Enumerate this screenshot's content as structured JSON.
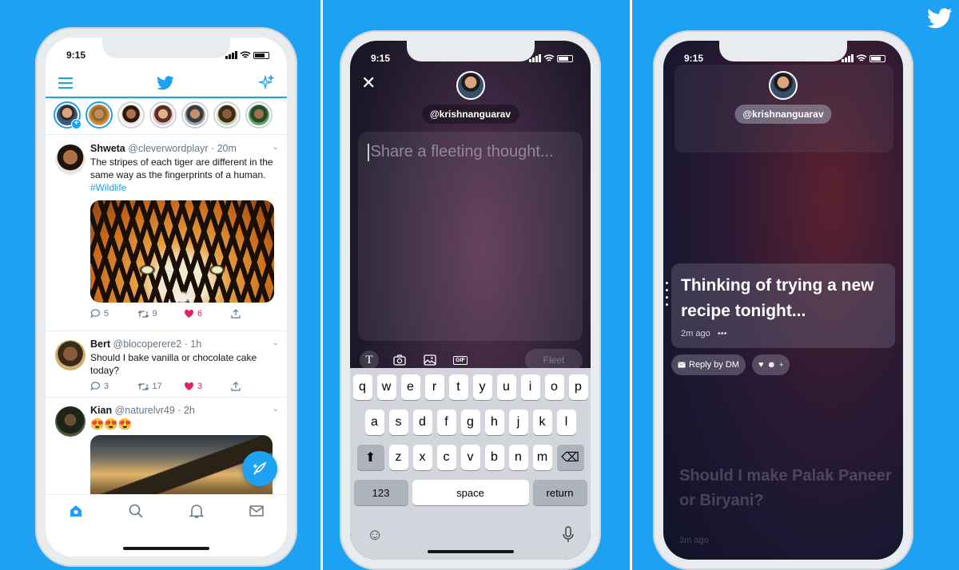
{
  "phone1": {
    "time": "9:15",
    "tweets": [
      {
        "name": "Shweta",
        "handle": "@cleverwordplayr",
        "time": "20m",
        "text": "The stripes of each tiger are different in the same way as the fingerprints of a human.",
        "hashtag": "#Wildlife",
        "replies": "5",
        "retweets": "9",
        "likes": "6"
      },
      {
        "name": "Bert",
        "handle": "@blocoperere2",
        "time": "1h",
        "text": "Should I bake vanilla or chocolate cake today?",
        "replies": "3",
        "retweets": "17",
        "likes": "3"
      },
      {
        "name": "Kian",
        "handle": "@naturelvr49",
        "time": "2h",
        "text": "😍😍😍"
      }
    ]
  },
  "phone2": {
    "time": "9:15",
    "handle": "@krishnanguarav",
    "placeholder": "Share a fleeting thought...",
    "fleet_button": "Fleet",
    "gif_label": "GIF",
    "text_tool_label": "T",
    "keyboard": {
      "row1": [
        "q",
        "w",
        "e",
        "r",
        "t",
        "y",
        "u",
        "i",
        "o",
        "p"
      ],
      "row2": [
        "a",
        "s",
        "d",
        "f",
        "g",
        "h",
        "j",
        "k",
        "l"
      ],
      "row3": [
        "z",
        "x",
        "c",
        "v",
        "b",
        "n",
        "m"
      ],
      "numbers_key": "123",
      "space_key": "space",
      "return_key": "return"
    }
  },
  "phone3": {
    "time": "9:15",
    "handle": "@krishnanguarav",
    "fleet_text": "Thinking of trying a new recipe tonight...",
    "fleet_time": "2m ago",
    "more": "•••",
    "reply_label": "Reply by DM",
    "reaction_plus": "+",
    "next_text": "Should I make Palak Paneer or Biryani?",
    "next_time": "3m ago"
  },
  "colors": {
    "brand": "#1da1f2",
    "like": "#e0245e"
  }
}
